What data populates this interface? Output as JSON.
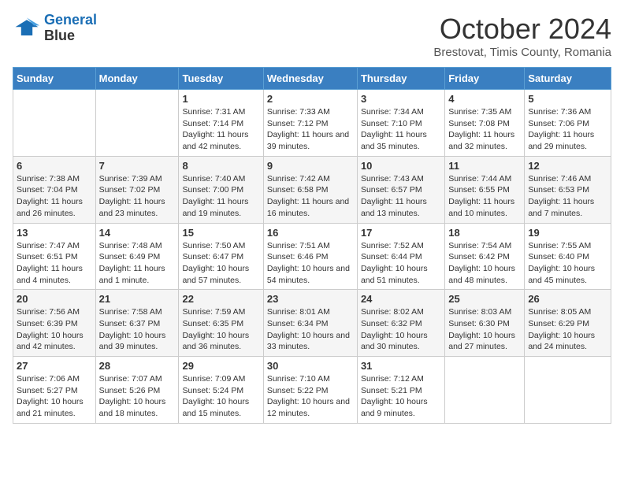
{
  "header": {
    "logo_line1": "General",
    "logo_line2": "Blue",
    "month": "October 2024",
    "location": "Brestovat, Timis County, Romania"
  },
  "days_of_week": [
    "Sunday",
    "Monday",
    "Tuesday",
    "Wednesday",
    "Thursday",
    "Friday",
    "Saturday"
  ],
  "weeks": [
    [
      {
        "day": "",
        "sunrise": "",
        "sunset": "",
        "daylight": ""
      },
      {
        "day": "",
        "sunrise": "",
        "sunset": "",
        "daylight": ""
      },
      {
        "day": "1",
        "sunrise": "Sunrise: 7:31 AM",
        "sunset": "Sunset: 7:14 PM",
        "daylight": "Daylight: 11 hours and 42 minutes."
      },
      {
        "day": "2",
        "sunrise": "Sunrise: 7:33 AM",
        "sunset": "Sunset: 7:12 PM",
        "daylight": "Daylight: 11 hours and 39 minutes."
      },
      {
        "day": "3",
        "sunrise": "Sunrise: 7:34 AM",
        "sunset": "Sunset: 7:10 PM",
        "daylight": "Daylight: 11 hours and 35 minutes."
      },
      {
        "day": "4",
        "sunrise": "Sunrise: 7:35 AM",
        "sunset": "Sunset: 7:08 PM",
        "daylight": "Daylight: 11 hours and 32 minutes."
      },
      {
        "day": "5",
        "sunrise": "Sunrise: 7:36 AM",
        "sunset": "Sunset: 7:06 PM",
        "daylight": "Daylight: 11 hours and 29 minutes."
      }
    ],
    [
      {
        "day": "6",
        "sunrise": "Sunrise: 7:38 AM",
        "sunset": "Sunset: 7:04 PM",
        "daylight": "Daylight: 11 hours and 26 minutes."
      },
      {
        "day": "7",
        "sunrise": "Sunrise: 7:39 AM",
        "sunset": "Sunset: 7:02 PM",
        "daylight": "Daylight: 11 hours and 23 minutes."
      },
      {
        "day": "8",
        "sunrise": "Sunrise: 7:40 AM",
        "sunset": "Sunset: 7:00 PM",
        "daylight": "Daylight: 11 hours and 19 minutes."
      },
      {
        "day": "9",
        "sunrise": "Sunrise: 7:42 AM",
        "sunset": "Sunset: 6:58 PM",
        "daylight": "Daylight: 11 hours and 16 minutes."
      },
      {
        "day": "10",
        "sunrise": "Sunrise: 7:43 AM",
        "sunset": "Sunset: 6:57 PM",
        "daylight": "Daylight: 11 hours and 13 minutes."
      },
      {
        "day": "11",
        "sunrise": "Sunrise: 7:44 AM",
        "sunset": "Sunset: 6:55 PM",
        "daylight": "Daylight: 11 hours and 10 minutes."
      },
      {
        "day": "12",
        "sunrise": "Sunrise: 7:46 AM",
        "sunset": "Sunset: 6:53 PM",
        "daylight": "Daylight: 11 hours and 7 minutes."
      }
    ],
    [
      {
        "day": "13",
        "sunrise": "Sunrise: 7:47 AM",
        "sunset": "Sunset: 6:51 PM",
        "daylight": "Daylight: 11 hours and 4 minutes."
      },
      {
        "day": "14",
        "sunrise": "Sunrise: 7:48 AM",
        "sunset": "Sunset: 6:49 PM",
        "daylight": "Daylight: 11 hours and 1 minute."
      },
      {
        "day": "15",
        "sunrise": "Sunrise: 7:50 AM",
        "sunset": "Sunset: 6:47 PM",
        "daylight": "Daylight: 10 hours and 57 minutes."
      },
      {
        "day": "16",
        "sunrise": "Sunrise: 7:51 AM",
        "sunset": "Sunset: 6:46 PM",
        "daylight": "Daylight: 10 hours and 54 minutes."
      },
      {
        "day": "17",
        "sunrise": "Sunrise: 7:52 AM",
        "sunset": "Sunset: 6:44 PM",
        "daylight": "Daylight: 10 hours and 51 minutes."
      },
      {
        "day": "18",
        "sunrise": "Sunrise: 7:54 AM",
        "sunset": "Sunset: 6:42 PM",
        "daylight": "Daylight: 10 hours and 48 minutes."
      },
      {
        "day": "19",
        "sunrise": "Sunrise: 7:55 AM",
        "sunset": "Sunset: 6:40 PM",
        "daylight": "Daylight: 10 hours and 45 minutes."
      }
    ],
    [
      {
        "day": "20",
        "sunrise": "Sunrise: 7:56 AM",
        "sunset": "Sunset: 6:39 PM",
        "daylight": "Daylight: 10 hours and 42 minutes."
      },
      {
        "day": "21",
        "sunrise": "Sunrise: 7:58 AM",
        "sunset": "Sunset: 6:37 PM",
        "daylight": "Daylight: 10 hours and 39 minutes."
      },
      {
        "day": "22",
        "sunrise": "Sunrise: 7:59 AM",
        "sunset": "Sunset: 6:35 PM",
        "daylight": "Daylight: 10 hours and 36 minutes."
      },
      {
        "day": "23",
        "sunrise": "Sunrise: 8:01 AM",
        "sunset": "Sunset: 6:34 PM",
        "daylight": "Daylight: 10 hours and 33 minutes."
      },
      {
        "day": "24",
        "sunrise": "Sunrise: 8:02 AM",
        "sunset": "Sunset: 6:32 PM",
        "daylight": "Daylight: 10 hours and 30 minutes."
      },
      {
        "day": "25",
        "sunrise": "Sunrise: 8:03 AM",
        "sunset": "Sunset: 6:30 PM",
        "daylight": "Daylight: 10 hours and 27 minutes."
      },
      {
        "day": "26",
        "sunrise": "Sunrise: 8:05 AM",
        "sunset": "Sunset: 6:29 PM",
        "daylight": "Daylight: 10 hours and 24 minutes."
      }
    ],
    [
      {
        "day": "27",
        "sunrise": "Sunrise: 7:06 AM",
        "sunset": "Sunset: 5:27 PM",
        "daylight": "Daylight: 10 hours and 21 minutes."
      },
      {
        "day": "28",
        "sunrise": "Sunrise: 7:07 AM",
        "sunset": "Sunset: 5:26 PM",
        "daylight": "Daylight: 10 hours and 18 minutes."
      },
      {
        "day": "29",
        "sunrise": "Sunrise: 7:09 AM",
        "sunset": "Sunset: 5:24 PM",
        "daylight": "Daylight: 10 hours and 15 minutes."
      },
      {
        "day": "30",
        "sunrise": "Sunrise: 7:10 AM",
        "sunset": "Sunset: 5:22 PM",
        "daylight": "Daylight: 10 hours and 12 minutes."
      },
      {
        "day": "31",
        "sunrise": "Sunrise: 7:12 AM",
        "sunset": "Sunset: 5:21 PM",
        "daylight": "Daylight: 10 hours and 9 minutes."
      },
      {
        "day": "",
        "sunrise": "",
        "sunset": "",
        "daylight": ""
      },
      {
        "day": "",
        "sunrise": "",
        "sunset": "",
        "daylight": ""
      }
    ]
  ]
}
